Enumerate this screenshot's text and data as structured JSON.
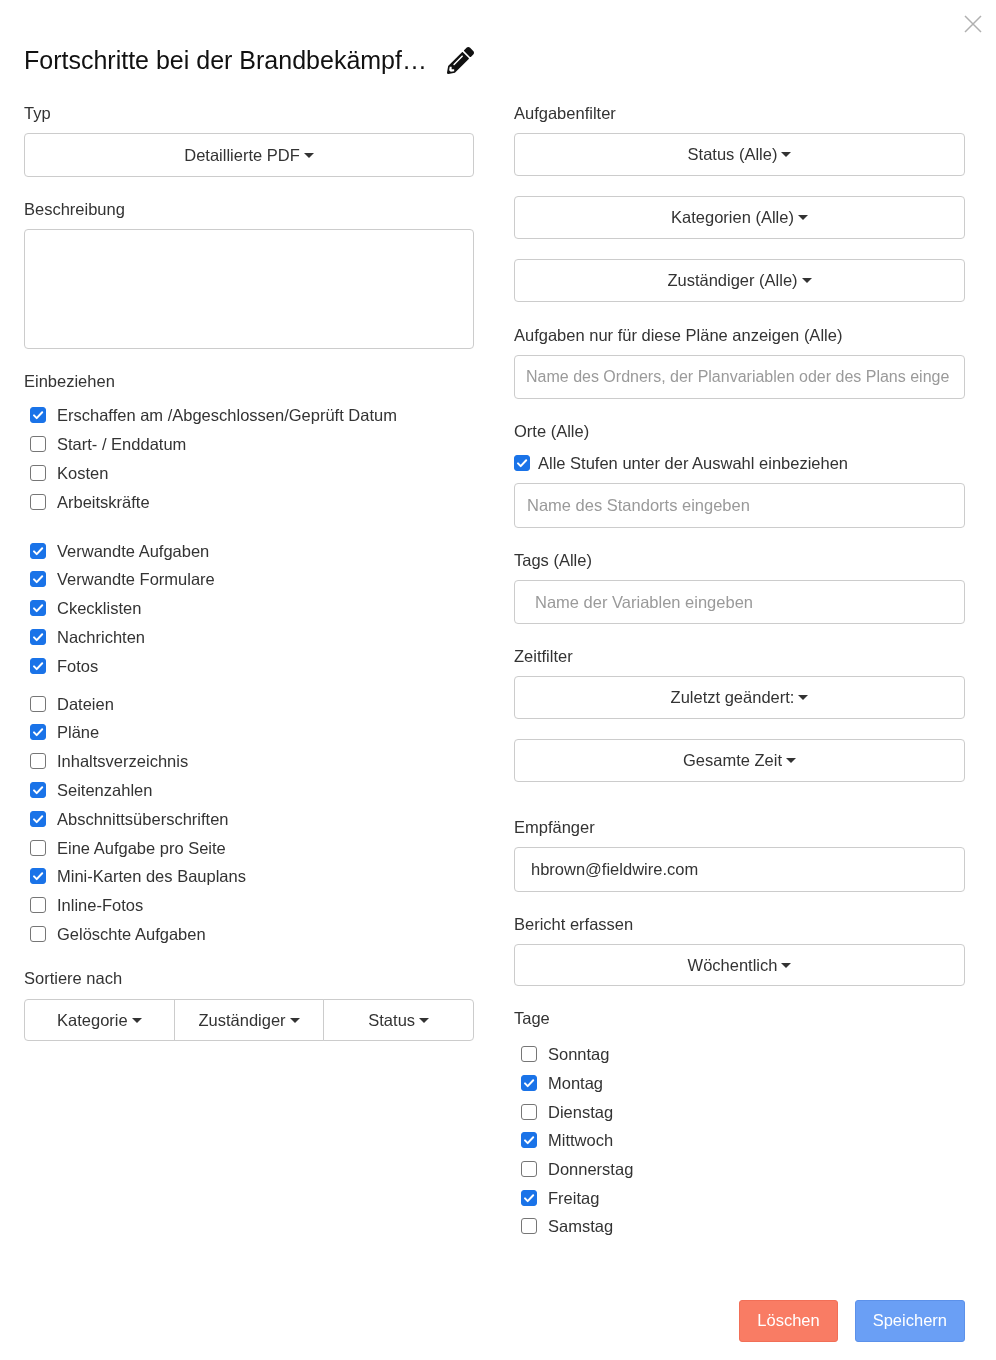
{
  "dialog": {
    "title": "Fortschritte bei der Brandbekämpf…"
  },
  "type": {
    "label": "Typ",
    "dropdown": "Detaillierte PDF"
  },
  "description": {
    "label": "Beschreibung"
  },
  "include": {
    "label": "Einbeziehen",
    "groups": [
      {
        "options": [
          {
            "label": "Erschaffen am /Abgeschlossen/Geprüft Datum",
            "checked": true
          },
          {
            "label": "Start- / Enddatum",
            "checked": false
          },
          {
            "label": "Kosten",
            "checked": false
          },
          {
            "label": "Arbeitskräfte",
            "checked": false
          }
        ]
      },
      {
        "options": [
          {
            "label": "Verwandte Aufgaben",
            "checked": true
          },
          {
            "label": "Verwandte Formulare",
            "checked": true
          },
          {
            "label": "Ckecklisten",
            "checked": true
          },
          {
            "label": "Nachrichten",
            "checked": true
          },
          {
            "label": "Fotos",
            "checked": true
          }
        ]
      },
      {
        "options": [
          {
            "label": "Dateien",
            "checked": false
          },
          {
            "label": "Pläne",
            "checked": true
          },
          {
            "label": "Inhaltsverzeichnis",
            "checked": false
          },
          {
            "label": "Seitenzahlen",
            "checked": true
          },
          {
            "label": "Abschnittsüberschriften",
            "checked": true
          },
          {
            "label": "Eine Aufgabe pro Seite",
            "checked": false
          },
          {
            "label": "Mini-Karten des Bauplans",
            "checked": true
          },
          {
            "label": "Inline-Fotos",
            "checked": false
          },
          {
            "label": "Gelöschte Aufgaben",
            "checked": false
          }
        ]
      }
    ]
  },
  "sort": {
    "label": "Sortiere nach",
    "buttons": [
      "Kategorie",
      "Zuständiger",
      "Status"
    ]
  },
  "task_filter": {
    "label": "Aufgabenfilter",
    "dropdowns": [
      "Status (Alle)",
      "Kategorien (Alle)",
      "Zuständiger (Alle)"
    ]
  },
  "plans": {
    "label": "Aufgaben nur für diese Pläne anzeigen (Alle)",
    "placeholder": "Name des Ordners, der Planvariablen oder des Plans einge"
  },
  "locations": {
    "label": "Orte (Alle)",
    "option": {
      "label": "Alle Stufen unter der Auswahl einbeziehen",
      "checked": true
    },
    "placeholder": "Name des Standorts eingeben"
  },
  "tags": {
    "label": "Tags (Alle)",
    "placeholder": "Name der Variablen eingeben"
  },
  "time_filter": {
    "label": "Zeitfilter",
    "dropdowns": [
      "Zuletzt geändert:",
      "Gesamte Zeit"
    ]
  },
  "recipients": {
    "label": "Empfänger",
    "value": "hbrown@fieldwire.com"
  },
  "frequency": {
    "label": "Bericht erfassen",
    "dropdown": "Wöchentlich"
  },
  "days": {
    "label": "Tage",
    "options": [
      {
        "label": "Sonntag",
        "checked": false
      },
      {
        "label": "Montag",
        "checked": true
      },
      {
        "label": "Dienstag",
        "checked": false
      },
      {
        "label": "Mittwoch",
        "checked": true
      },
      {
        "label": "Donnerstag",
        "checked": false
      },
      {
        "label": "Freitag",
        "checked": true
      },
      {
        "label": "Samstag",
        "checked": false
      }
    ]
  },
  "footer": {
    "buttons": [
      {
        "label": "Löschen",
        "kind": "danger"
      },
      {
        "label": "Speichern",
        "kind": "primary"
      }
    ]
  }
}
